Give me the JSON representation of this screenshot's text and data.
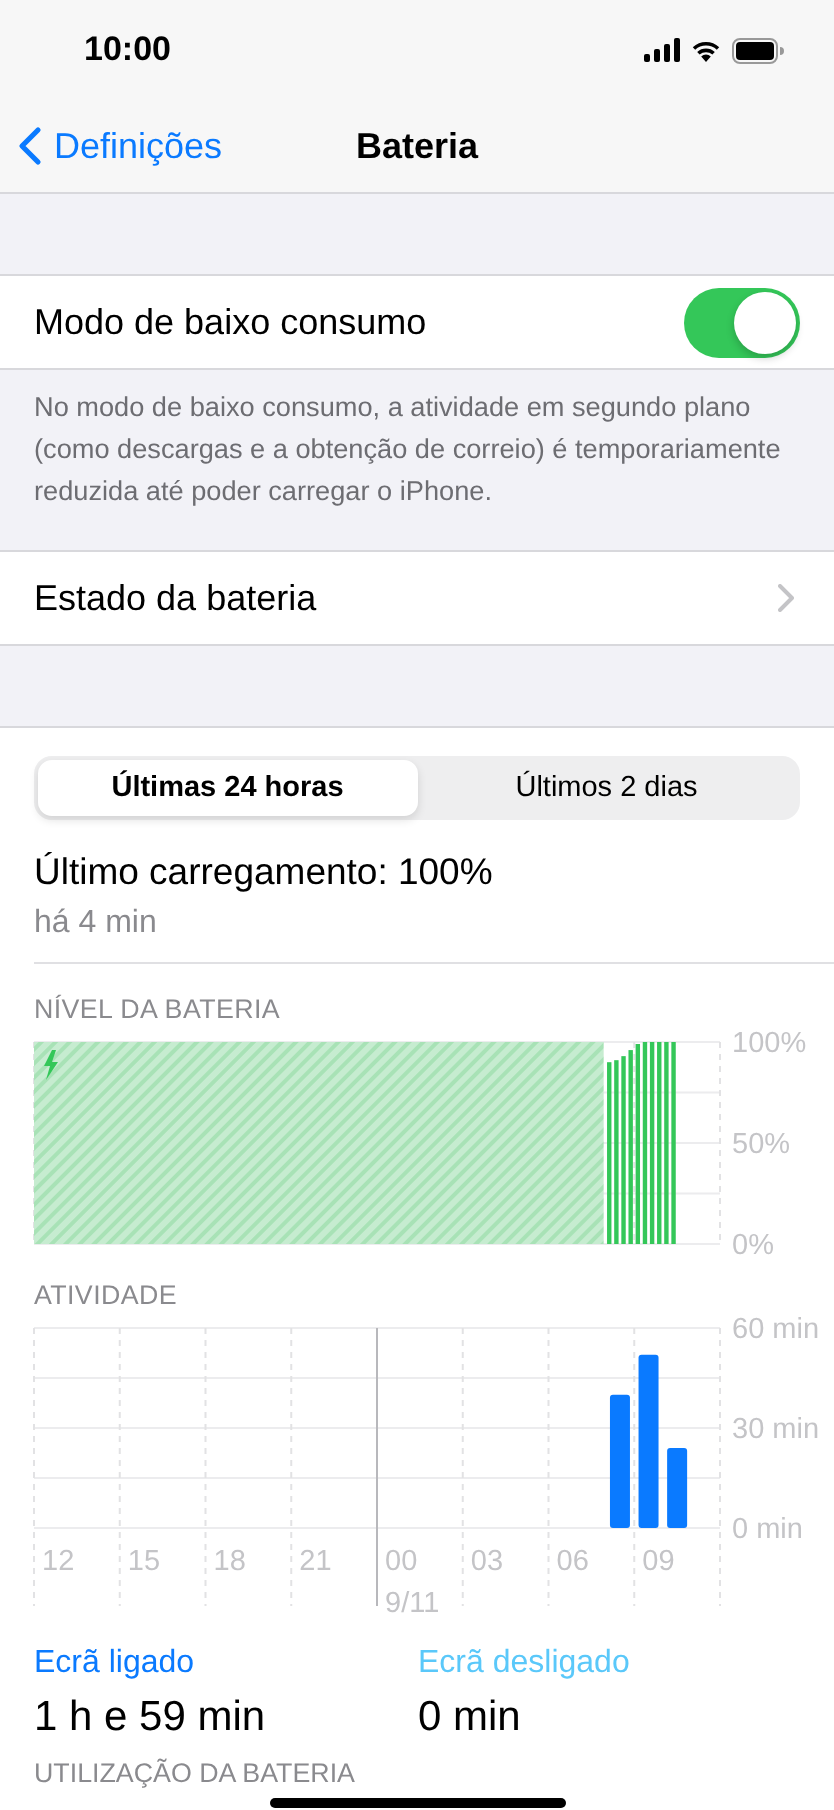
{
  "status_bar": {
    "time": "10:00"
  },
  "nav": {
    "back": "Definições",
    "title": "Bateria"
  },
  "low_power": {
    "label": "Modo de baixo consumo",
    "on": true,
    "footer": "No modo de baixo consumo, a atividade em segundo plano (como descargas e a obtenção de correio) é temporariamente reduzida até poder carregar o iPhone."
  },
  "battery_health": {
    "label": "Estado da bateria"
  },
  "segments": [
    {
      "label": "Últimas 24 horas",
      "selected": true
    },
    {
      "label": "Últimos 2 dias",
      "selected": false
    }
  ],
  "last_charge": {
    "title": "Último carregamento: 100%",
    "time": "há 4 min"
  },
  "battery_level": {
    "heading": "NÍVEL DA BATERIA",
    "charging": true,
    "chart_data": {
      "type": "bar",
      "categories": [
        null,
        null,
        null,
        null,
        null,
        null,
        null,
        null,
        null,
        null,
        null,
        null,
        null,
        null,
        null,
        null,
        null,
        null,
        null,
        null,
        null,
        null,
        null,
        null,
        null,
        null,
        null,
        null,
        null,
        null,
        null,
        null,
        null,
        null,
        null,
        null,
        null,
        null,
        null,
        null,
        null,
        null,
        null,
        null,
        null,
        null,
        null,
        null,
        null,
        null,
        null,
        null,
        null,
        null,
        null,
        null,
        null,
        null,
        null,
        null,
        null,
        null,
        null,
        null,
        null,
        null,
        null,
        null,
        null,
        null,
        null,
        null,
        null,
        null,
        null,
        null,
        null,
        null,
        null,
        null,
        null,
        null,
        null,
        null,
        null,
        null,
        null,
        null,
        null,
        null,
        null,
        null,
        null,
        null,
        null,
        null
      ],
      "values": [
        null,
        null,
        null,
        null,
        null,
        null,
        null,
        null,
        null,
        null,
        null,
        null,
        null,
        null,
        null,
        null,
        null,
        null,
        null,
        null,
        null,
        null,
        null,
        null,
        null,
        null,
        null,
        null,
        null,
        null,
        null,
        null,
        null,
        null,
        null,
        null,
        null,
        null,
        null,
        null,
        null,
        null,
        null,
        null,
        null,
        null,
        null,
        null,
        null,
        null,
        null,
        null,
        null,
        null,
        null,
        null,
        null,
        null,
        null,
        null,
        null,
        null,
        null,
        null,
        null,
        null,
        null,
        null,
        null,
        null,
        null,
        null,
        null,
        null,
        null,
        null,
        null,
        null,
        null,
        null,
        90,
        91,
        93,
        96,
        99,
        100,
        100,
        100,
        100,
        100,
        null,
        null,
        null,
        null,
        null,
        null
      ],
      "grid": true,
      "ylim": [
        0,
        100
      ],
      "yticks": [
        {
          "value": 0,
          "label": "0%"
        },
        {
          "value": 50,
          "label": "50%"
        },
        {
          "value": 100,
          "label": "100%"
        }
      ]
    }
  },
  "activity": {
    "heading": "ATIVIDADE",
    "date_label": "9/11",
    "chart_data": {
      "type": "bar",
      "categories": [
        "12",
        null,
        null,
        "15",
        null,
        null,
        "18",
        null,
        null,
        "21",
        null,
        null,
        "00",
        null,
        null,
        "03",
        null,
        null,
        "06",
        null,
        null,
        "09",
        null,
        null
      ],
      "values": [
        null,
        null,
        null,
        null,
        null,
        null,
        null,
        null,
        null,
        null,
        null,
        null,
        null,
        null,
        null,
        null,
        null,
        null,
        null,
        null,
        40,
        52,
        24,
        null
      ],
      "grid": true,
      "ylim": [
        0,
        60
      ],
      "yticks": [
        {
          "value": 0,
          "label": "0 min"
        },
        {
          "value": 30,
          "label": "30 min"
        },
        {
          "value": 60,
          "label": "60 min"
        }
      ]
    }
  },
  "screen_time": [
    {
      "label": "Ecrã ligado",
      "value": "1 h e 59 min",
      "color": "#0a7aff"
    },
    {
      "label": "Ecrã desligado",
      "value": "0 min",
      "color": "#5ac8fa"
    }
  ],
  "next_section": {
    "heading": "UTILIZAÇÃO DA BATERIA"
  }
}
